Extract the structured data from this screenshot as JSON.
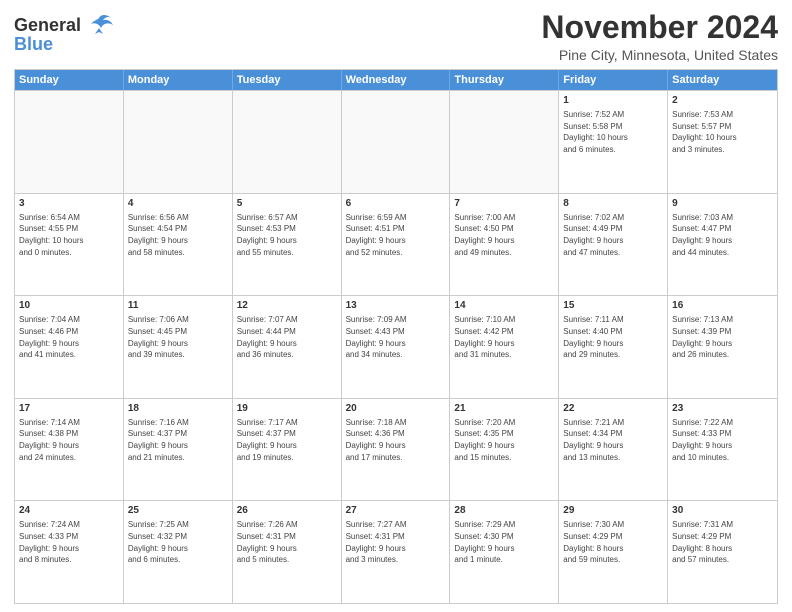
{
  "header": {
    "logo_general": "General",
    "logo_blue": "Blue",
    "month_title": "November 2024",
    "location": "Pine City, Minnesota, United States"
  },
  "days_of_week": [
    "Sunday",
    "Monday",
    "Tuesday",
    "Wednesday",
    "Thursday",
    "Friday",
    "Saturday"
  ],
  "weeks": [
    [
      {
        "day": "",
        "info": "",
        "empty": true
      },
      {
        "day": "",
        "info": "",
        "empty": true
      },
      {
        "day": "",
        "info": "",
        "empty": true
      },
      {
        "day": "",
        "info": "",
        "empty": true
      },
      {
        "day": "",
        "info": "",
        "empty": true
      },
      {
        "day": "1",
        "info": "Sunrise: 7:52 AM\nSunset: 5:58 PM\nDaylight: 10 hours\nand 6 minutes."
      },
      {
        "day": "2",
        "info": "Sunrise: 7:53 AM\nSunset: 5:57 PM\nDaylight: 10 hours\nand 3 minutes."
      }
    ],
    [
      {
        "day": "3",
        "info": "Sunrise: 6:54 AM\nSunset: 4:55 PM\nDaylight: 10 hours\nand 0 minutes."
      },
      {
        "day": "4",
        "info": "Sunrise: 6:56 AM\nSunset: 4:54 PM\nDaylight: 9 hours\nand 58 minutes."
      },
      {
        "day": "5",
        "info": "Sunrise: 6:57 AM\nSunset: 4:53 PM\nDaylight: 9 hours\nand 55 minutes."
      },
      {
        "day": "6",
        "info": "Sunrise: 6:59 AM\nSunset: 4:51 PM\nDaylight: 9 hours\nand 52 minutes."
      },
      {
        "day": "7",
        "info": "Sunrise: 7:00 AM\nSunset: 4:50 PM\nDaylight: 9 hours\nand 49 minutes."
      },
      {
        "day": "8",
        "info": "Sunrise: 7:02 AM\nSunset: 4:49 PM\nDaylight: 9 hours\nand 47 minutes."
      },
      {
        "day": "9",
        "info": "Sunrise: 7:03 AM\nSunset: 4:47 PM\nDaylight: 9 hours\nand 44 minutes."
      }
    ],
    [
      {
        "day": "10",
        "info": "Sunrise: 7:04 AM\nSunset: 4:46 PM\nDaylight: 9 hours\nand 41 minutes."
      },
      {
        "day": "11",
        "info": "Sunrise: 7:06 AM\nSunset: 4:45 PM\nDaylight: 9 hours\nand 39 minutes."
      },
      {
        "day": "12",
        "info": "Sunrise: 7:07 AM\nSunset: 4:44 PM\nDaylight: 9 hours\nand 36 minutes."
      },
      {
        "day": "13",
        "info": "Sunrise: 7:09 AM\nSunset: 4:43 PM\nDaylight: 9 hours\nand 34 minutes."
      },
      {
        "day": "14",
        "info": "Sunrise: 7:10 AM\nSunset: 4:42 PM\nDaylight: 9 hours\nand 31 minutes."
      },
      {
        "day": "15",
        "info": "Sunrise: 7:11 AM\nSunset: 4:40 PM\nDaylight: 9 hours\nand 29 minutes."
      },
      {
        "day": "16",
        "info": "Sunrise: 7:13 AM\nSunset: 4:39 PM\nDaylight: 9 hours\nand 26 minutes."
      }
    ],
    [
      {
        "day": "17",
        "info": "Sunrise: 7:14 AM\nSunset: 4:38 PM\nDaylight: 9 hours\nand 24 minutes."
      },
      {
        "day": "18",
        "info": "Sunrise: 7:16 AM\nSunset: 4:37 PM\nDaylight: 9 hours\nand 21 minutes."
      },
      {
        "day": "19",
        "info": "Sunrise: 7:17 AM\nSunset: 4:37 PM\nDaylight: 9 hours\nand 19 minutes."
      },
      {
        "day": "20",
        "info": "Sunrise: 7:18 AM\nSunset: 4:36 PM\nDaylight: 9 hours\nand 17 minutes."
      },
      {
        "day": "21",
        "info": "Sunrise: 7:20 AM\nSunset: 4:35 PM\nDaylight: 9 hours\nand 15 minutes."
      },
      {
        "day": "22",
        "info": "Sunrise: 7:21 AM\nSunset: 4:34 PM\nDaylight: 9 hours\nand 13 minutes."
      },
      {
        "day": "23",
        "info": "Sunrise: 7:22 AM\nSunset: 4:33 PM\nDaylight: 9 hours\nand 10 minutes."
      }
    ],
    [
      {
        "day": "24",
        "info": "Sunrise: 7:24 AM\nSunset: 4:33 PM\nDaylight: 9 hours\nand 8 minutes."
      },
      {
        "day": "25",
        "info": "Sunrise: 7:25 AM\nSunset: 4:32 PM\nDaylight: 9 hours\nand 6 minutes."
      },
      {
        "day": "26",
        "info": "Sunrise: 7:26 AM\nSunset: 4:31 PM\nDaylight: 9 hours\nand 5 minutes."
      },
      {
        "day": "27",
        "info": "Sunrise: 7:27 AM\nSunset: 4:31 PM\nDaylight: 9 hours\nand 3 minutes."
      },
      {
        "day": "28",
        "info": "Sunrise: 7:29 AM\nSunset: 4:30 PM\nDaylight: 9 hours\nand 1 minute."
      },
      {
        "day": "29",
        "info": "Sunrise: 7:30 AM\nSunset: 4:29 PM\nDaylight: 8 hours\nand 59 minutes."
      },
      {
        "day": "30",
        "info": "Sunrise: 7:31 AM\nSunset: 4:29 PM\nDaylight: 8 hours\nand 57 minutes."
      }
    ]
  ]
}
